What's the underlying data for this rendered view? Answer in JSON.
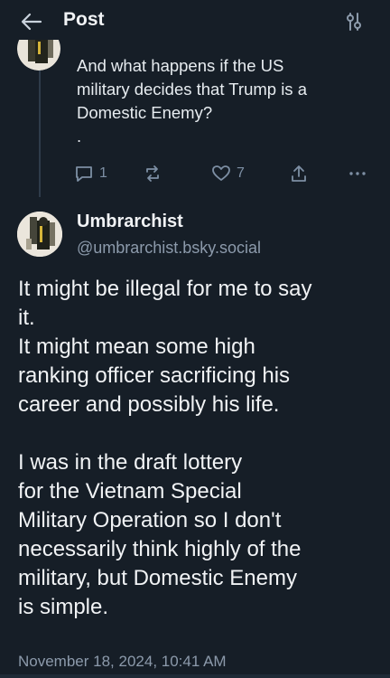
{
  "header": {
    "title": "Post",
    "back_icon": "arrow-left-icon",
    "filter_icon": "sliders-icon"
  },
  "parent_post": {
    "text_lines": [
      "And what happens if the US",
      "military decides that Trump is a",
      "Domestic Enemy?",
      "."
    ],
    "reply_count": "1",
    "like_count": "7",
    "icons": [
      "reply-icon",
      "repost-icon",
      "like-icon",
      "share-icon",
      "more-icon"
    ]
  },
  "main_post": {
    "author_name": "Umbrarchist",
    "author_handle": "@umbrarchist.bsky.social",
    "paragraph1": [
      "It might be illegal for me to say",
      "it.",
      "It might mean some high",
      "ranking officer sacrificing his",
      "career and possibly his life."
    ],
    "paragraph2": [
      "I was in the draft lottery",
      "for the Vietnam Special",
      "Military Operation so I don't",
      "necessarily think highly of the",
      "military, but Domestic Enemy",
      "is simple."
    ],
    "timestamp": "November 18, 2024, 10:41 AM"
  },
  "colors": {
    "background": "#161e27",
    "muted": "#8c9aab",
    "icon": "#7d8fa4",
    "thread_line": "#2e3b4a"
  }
}
